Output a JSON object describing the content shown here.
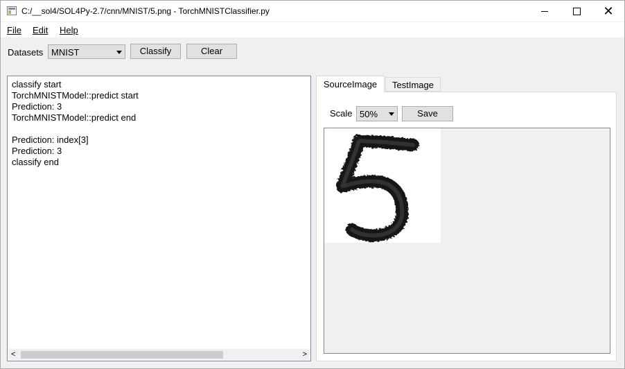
{
  "window": {
    "title": "C:/__sol4/SOL4Py-2.7/cnn/MNIST/5.png - TorchMNISTClassifier.py",
    "minimize_icon": "minimize-icon",
    "maximize_icon": "maximize-icon",
    "close_icon": "close-icon",
    "close_glyph": "✕"
  },
  "menu": {
    "items": [
      {
        "label": "File"
      },
      {
        "label": "Edit"
      },
      {
        "label": "Help"
      }
    ]
  },
  "toolbar": {
    "datasets_label": "Datasets",
    "dataset_selected": "MNIST",
    "classify_label": "Classify",
    "clear_label": "Clear"
  },
  "log": {
    "lines": "classify start\nTorchMNISTModel::predict start\nPrediction: 3\nTorchMNISTModel::predict end\n\nPrediction: index[3]\nPrediction: 3\nclassify end",
    "scroll_left": "<",
    "scroll_right": ">"
  },
  "tabs": [
    {
      "label": "SourceImage",
      "active": true
    },
    {
      "label": "TestImage",
      "active": false
    }
  ],
  "source_image": {
    "scale_label": "Scale",
    "scale_value": "50%",
    "save_label": "Save",
    "digit_image": "handwritten-digit-5-image"
  }
}
